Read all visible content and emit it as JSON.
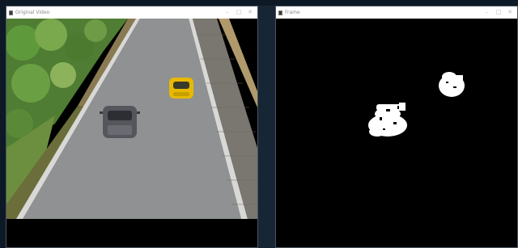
{
  "windows": {
    "left": {
      "title": "Original Video",
      "icon": "opencv-window-icon",
      "controls": [
        "minimize",
        "maximize",
        "close"
      ]
    },
    "right": {
      "title": "Frame",
      "icon": "opencv-window-icon",
      "controls": [
        "minimize",
        "maximize",
        "close"
      ]
    }
  },
  "glyphs": {
    "minimize": "–",
    "maximize": "□",
    "close": "✕"
  },
  "colors": {
    "road": "#8f9192",
    "grass": "#5d8a3a",
    "pavement": "#7a7670",
    "yellow_car": "#e8b900",
    "dark_car": "#55565c",
    "mask_background": "#000000",
    "mask_foreground": "#ffffff"
  }
}
